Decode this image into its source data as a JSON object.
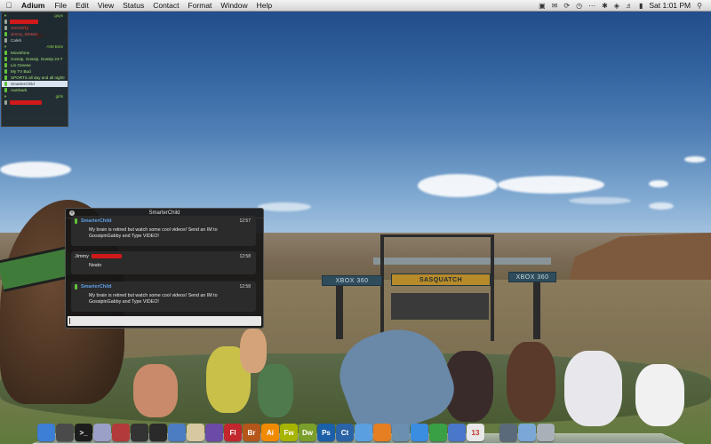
{
  "menubar": {
    "app_name": "Adium",
    "menus": [
      "File",
      "Edit",
      "View",
      "Status",
      "Contact",
      "Format",
      "Window",
      "Help"
    ],
    "clock": "Sat 1:01 PM"
  },
  "buddy_list": {
    "groups": [
      {
        "name": "guys",
        "buddies": [
          {
            "name": "",
            "redacted": true,
            "idle": true
          },
          {
            "name": "GerrishTy",
            "redacted": false,
            "idle": true
          },
          {
            "name": "Jimmy_Brittain",
            "redacted": false,
            "idle": false
          },
          {
            "name": "Caleb",
            "redacted": false,
            "idle": true
          }
        ]
      },
      {
        "name": "AIM Bots",
        "buddies": [
          {
            "name": "Moviefone",
            "redacted": false,
            "idle": false
          },
          {
            "name": "Gossip, Gossip, Gossip 24-7",
            "redacted": false,
            "idle": false
          },
          {
            "name": "Lin Greene",
            "redacted": false,
            "idle": false
          },
          {
            "name": "My TV Bud",
            "redacted": false,
            "idle": false
          },
          {
            "name": "SPORTS all day and all night!",
            "redacted": false,
            "idle": false
          },
          {
            "name": "SmarterChild",
            "redacted": false,
            "idle": false,
            "selected": true
          },
          {
            "name": "Aardvark",
            "redacted": false,
            "idle": false
          }
        ]
      },
      {
        "name": "girls",
        "buddies": [
          {
            "name": "",
            "redacted": true,
            "idle": true
          }
        ]
      }
    ]
  },
  "chat": {
    "title": "SmarterChild",
    "close_icon": "×",
    "messages": [
      {
        "sender": "SmarterChild",
        "time": "12:57",
        "text": "My brain is retired but watch some cool videos! Send an IM to GossipinGabby and Type VIDEO!"
      },
      {
        "sender": "Jimmy",
        "time": "12:58",
        "text": "Neato",
        "redacted_name": true
      },
      {
        "sender": "SmarterChild",
        "time": "12:58",
        "text": "My brain is retired but watch some cool videos! Send an IM to GossipinGabby and Type VIDEO!"
      }
    ]
  },
  "wallpaper": {
    "banner_left": "XBOX 360",
    "banner_center": "SASQUATCH",
    "banner_right": "XBOX 360"
  },
  "dock": {
    "items": [
      {
        "name": "finder-icon",
        "label": "",
        "color": "#3d7fd6"
      },
      {
        "name": "compass-icon",
        "label": "",
        "color": "#4a4a4a"
      },
      {
        "name": "terminal-icon",
        "label": ">_",
        "color": "#1c1c1c"
      },
      {
        "name": "cd-icon",
        "label": "",
        "color": "#9aa0c8"
      },
      {
        "name": "photobooth-icon",
        "label": "",
        "color": "#b23a3a"
      },
      {
        "name": "camera-icon",
        "label": "",
        "color": "#333"
      },
      {
        "name": "clapper-icon",
        "label": "",
        "color": "#2a2a2a"
      },
      {
        "name": "xcode-icon",
        "label": "",
        "color": "#4c7dc3"
      },
      {
        "name": "textedit-icon",
        "label": "",
        "color": "#d8c8a0"
      },
      {
        "name": "contribute-icon",
        "label": "",
        "color": "#6b4ba5"
      },
      {
        "name": "flash-icon",
        "label": "Fl",
        "color": "#c1272d"
      },
      {
        "name": "bridge-icon",
        "label": "Br",
        "color": "#b5561b"
      },
      {
        "name": "illustrator-icon",
        "label": "Ai",
        "color": "#f08a00"
      },
      {
        "name": "fireworks-icon",
        "label": "Fw",
        "color": "#a7b400"
      },
      {
        "name": "dreamweaver-icon",
        "label": "Dw",
        "color": "#7a9f2a"
      },
      {
        "name": "photoshop-icon",
        "label": "Ps",
        "color": "#1a5fa8"
      },
      {
        "name": "contribute-cs-icon",
        "label": "Ct",
        "color": "#2b64a6"
      },
      {
        "name": "safari-icon",
        "label": "",
        "color": "#5aa0e0"
      },
      {
        "name": "firefox-icon",
        "label": "",
        "color": "#e67e22"
      },
      {
        "name": "preview-icon",
        "label": "",
        "color": "#6b8fae"
      },
      {
        "name": "itunes-icon",
        "label": "",
        "color": "#3a8de0"
      },
      {
        "name": "adium-icon",
        "label": "",
        "color": "#3aa046"
      },
      {
        "name": "mail-icon",
        "label": "",
        "color": "#4a77c9"
      },
      {
        "name": "ical-icon",
        "label": "13",
        "color": "#e8e8e8"
      },
      {
        "name": "timemachine-icon",
        "label": "",
        "color": "#5a6a7a"
      },
      {
        "name": "folder-icon",
        "label": "",
        "color": "#7aa7d6"
      },
      {
        "name": "trash-icon",
        "label": "",
        "color": "#a8b0b8"
      }
    ]
  }
}
